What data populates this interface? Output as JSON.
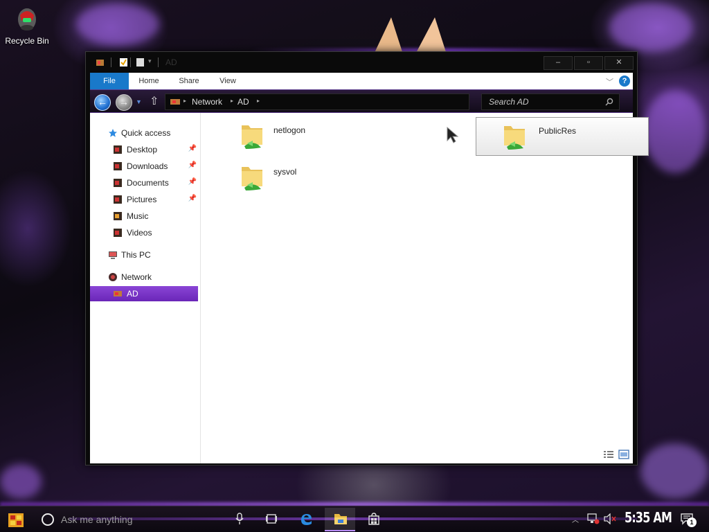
{
  "desktop": {
    "recycle_bin_label": "Recycle Bin"
  },
  "window": {
    "title": "AD",
    "controls": {
      "minimize": "‒",
      "maximize": "▫",
      "close": "✕"
    },
    "ribbon": {
      "tabs": [
        "File",
        "Home",
        "Share",
        "View"
      ],
      "help": "?"
    },
    "navigation": {
      "breadcrumb": [
        "Network",
        "AD"
      ],
      "search_placeholder": "Search AD"
    },
    "nav_pane": {
      "items": [
        {
          "label": "Quick access",
          "icon": "star-icon",
          "pinned": false
        },
        {
          "label": "Desktop",
          "icon": "desktop-icon",
          "pinned": true
        },
        {
          "label": "Downloads",
          "icon": "downloads-icon",
          "pinned": true
        },
        {
          "label": "Documents",
          "icon": "documents-icon",
          "pinned": true
        },
        {
          "label": "Pictures",
          "icon": "pictures-icon",
          "pinned": true
        },
        {
          "label": "Music",
          "icon": "music-icon",
          "pinned": false
        },
        {
          "label": "Videos",
          "icon": "videos-icon",
          "pinned": false
        },
        {
          "label": "This PC",
          "icon": "this-pc-icon",
          "pinned": false
        },
        {
          "label": "Network",
          "icon": "network-icon",
          "pinned": false
        },
        {
          "label": "AD",
          "icon": "server-icon",
          "pinned": false,
          "selected": true
        }
      ]
    },
    "files": [
      {
        "name": "netlogon",
        "type": "shared-folder",
        "selected": false
      },
      {
        "name": "PublicRes",
        "type": "shared-folder",
        "selected": true
      },
      {
        "name": "sysvol",
        "type": "shared-folder",
        "selected": false
      }
    ]
  },
  "taskbar": {
    "search_placeholder": "Ask me anything",
    "clock": "5:35 AM",
    "notification_count": "1",
    "apps": [
      "task-view-icon",
      "edge-icon",
      "file-explorer-icon",
      "store-icon"
    ]
  },
  "colors": {
    "accent_blue": "#1979ca",
    "selection_purple": "#7a35c8",
    "window_frame": "#0a0a0a"
  }
}
